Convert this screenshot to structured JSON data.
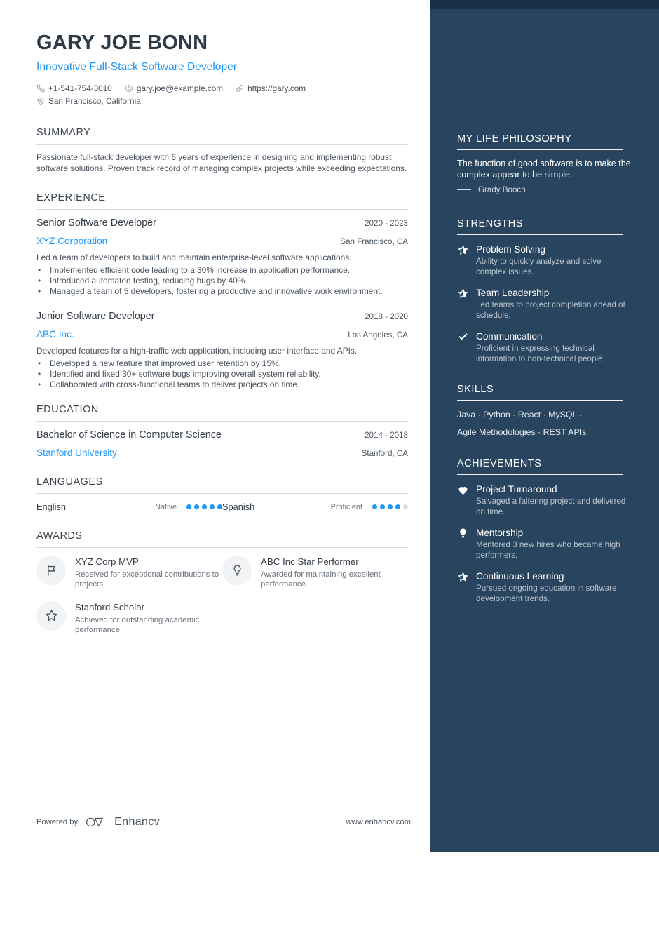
{
  "header": {
    "name": "GARY JOE BONN",
    "role": "Innovative Full-Stack Software Developer",
    "contacts": [
      {
        "icon": "phone-icon",
        "text": "+1-541-754-3010"
      },
      {
        "icon": "email-icon",
        "text": "gary.joe@example.com"
      },
      {
        "icon": "link-icon",
        "text": "https://gary.com"
      },
      {
        "icon": "location-pin-icon",
        "text": "San Francisco, California"
      }
    ]
  },
  "summary": {
    "heading": "SUMMARY",
    "text": "Passionate full-stack developer with 6 years of experience in designing and implementing robust software solutions. Proven track record of managing complex projects while exceeding expectations."
  },
  "experience": {
    "heading": "EXPERIENCE",
    "jobs": [
      {
        "title": "Senior Software Developer",
        "dates": "2020 - 2023",
        "org": "XYZ Corporation",
        "location": "San Francisco, CA",
        "desc": "Led a team of developers to build and maintain enterprise-level software applications.",
        "bullets": [
          "Implemented efficient code leading to a 30% increase in application performance.",
          "Introduced automated testing, reducing bugs by 40%.",
          "Managed a team of 5 developers, fostering a productive and innovative work environment."
        ]
      },
      {
        "title": "Junior Software Developer",
        "dates": "2018 - 2020",
        "org": "ABC Inc.",
        "location": "Los Angeles, CA",
        "desc": "Developed features for a high-traffic web application, including user interface and APIs.",
        "bullets": [
          "Developed a new feature that improved user retention by 15%.",
          "Identified and fixed 30+ software bugs improving overall system reliability.",
          "Collaborated with cross-functional teams to deliver projects on time."
        ]
      }
    ]
  },
  "education": {
    "heading": "EDUCATION",
    "entries": [
      {
        "degree": "Bachelor of Science in Computer Science",
        "dates": "2014 - 2018",
        "school": "Stanford University",
        "location": "Stanford, CA"
      }
    ]
  },
  "languages": {
    "heading": "LANGUAGES",
    "items": [
      {
        "name": "English",
        "level": "Native",
        "filled": 5,
        "total": 5
      },
      {
        "name": "Spanish",
        "level": "Proficient",
        "filled": 4,
        "total": 5
      }
    ]
  },
  "awards": {
    "heading": "AWARDS",
    "items": [
      {
        "icon": "flag-icon",
        "title": "XYZ Corp MVP",
        "desc": "Received for exceptional contributions to projects."
      },
      {
        "icon": "lightbulb-icon",
        "title": "ABC Inc Star Performer",
        "desc": "Awarded for maintaining excellent performance."
      },
      {
        "icon": "star-outline-icon",
        "title": "Stanford Scholar",
        "desc": "Achieved for outstanding academic performance."
      }
    ]
  },
  "philosophy": {
    "heading": "MY LIFE PHILOSOPHY",
    "quote": "The function of good software is to make the complex appear to be simple.",
    "author": "Grady Booch"
  },
  "strengths": {
    "heading": "STRENGTHS",
    "items": [
      {
        "icon": "half-star-icon",
        "title": "Problem Solving",
        "desc": "Ability to quickly analyze and solve complex issues."
      },
      {
        "icon": "half-star-icon",
        "title": "Team Leadership",
        "desc": "Led teams to project completion ahead of schedule."
      },
      {
        "icon": "check-icon",
        "title": "Communication",
        "desc": "Proficient in expressing technical information to non-technical people."
      }
    ]
  },
  "skills": {
    "heading": "SKILLS",
    "lines": [
      "Java · Python · React · MySQL ·",
      "Agile Methodologies · REST APIs"
    ]
  },
  "achievements": {
    "heading": "ACHIEVEMENTS",
    "items": [
      {
        "icon": "heart-icon",
        "title": "Project Turnaround",
        "desc": "Salvaged a faltering project and delivered on time."
      },
      {
        "icon": "lightbulb-icon",
        "title": "Mentorship",
        "desc": "Mentored 3 new hires who became high performers."
      },
      {
        "icon": "half-star-icon",
        "title": "Continuous Learning",
        "desc": "Pursued ongoing education in software development trends."
      }
    ]
  },
  "footer": {
    "powered_by": "Powered by",
    "brand": "Enhancv",
    "url": "www.enhancv.com"
  },
  "colors": {
    "sidebar": "#28445e",
    "sidebar_cap": "#1a3048",
    "accent": "#2196f3",
    "heading": "#3c4450",
    "body": "#4a545f"
  }
}
